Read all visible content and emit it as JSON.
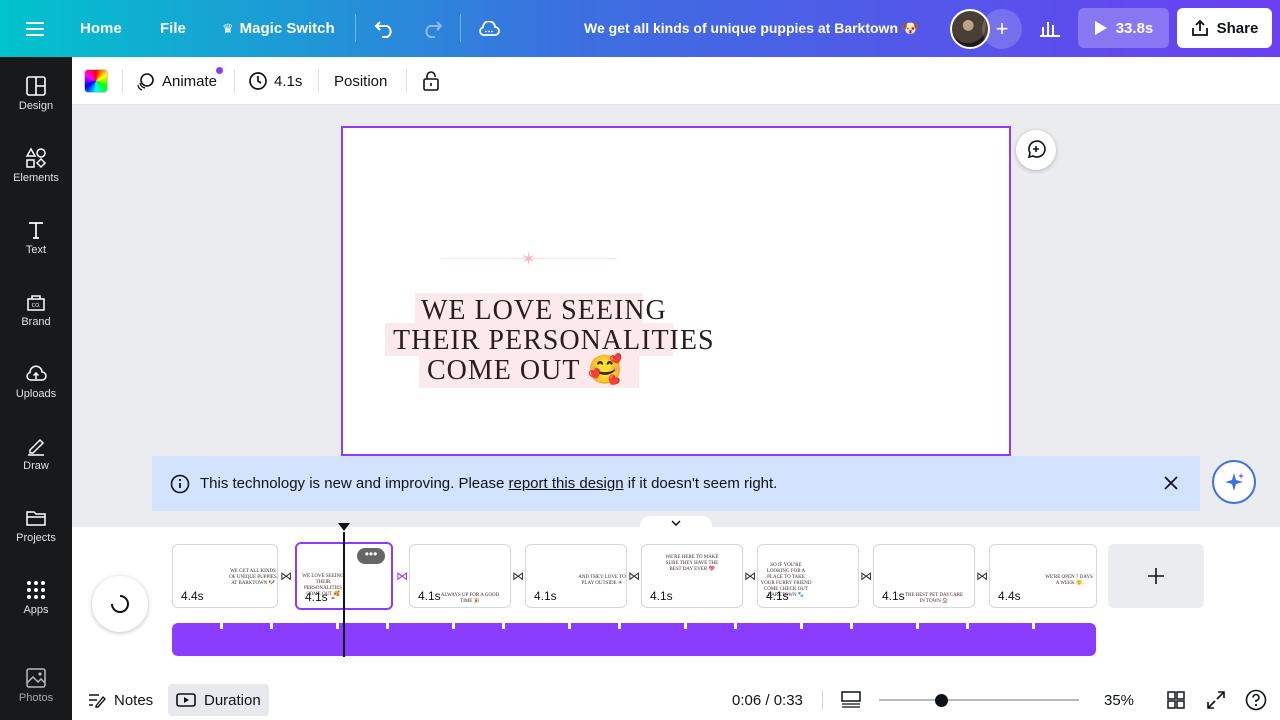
{
  "topbar": {
    "home": "Home",
    "file": "File",
    "magic_switch": "Magic Switch",
    "doc_title": "We get all kinds of unique puppies at Barktown 🐶",
    "play_time": "33.8s",
    "share": "Share"
  },
  "sidebar": {
    "items": [
      {
        "label": "Design",
        "icon": "layout-icon"
      },
      {
        "label": "Elements",
        "icon": "shapes-icon"
      },
      {
        "label": "Text",
        "icon": "text-icon"
      },
      {
        "label": "Brand",
        "icon": "brand-icon"
      },
      {
        "label": "Uploads",
        "icon": "upload-icon"
      },
      {
        "label": "Draw",
        "icon": "draw-icon"
      },
      {
        "label": "Projects",
        "icon": "folder-icon"
      },
      {
        "label": "Apps",
        "icon": "apps-icon"
      },
      {
        "label": "Photos",
        "icon": "photos-icon"
      }
    ]
  },
  "toolbar": {
    "animate": "Animate",
    "duration": "4.1s",
    "position": "Position"
  },
  "canvas": {
    "line1": "WE LOVE SEEING",
    "line2": "THEIR PERSONALITIES",
    "line3": "COME OUT 🥰"
  },
  "banner": {
    "text_before": "This technology is new and improving. Please ",
    "link": "report this design",
    "text_after": " if it doesn't seem right."
  },
  "scenes": [
    {
      "duration": "4.4s",
      "mini": "WE GET ALL KINDS OF UNIQUE PUPPIES AT BARKTOWN 🐶"
    },
    {
      "duration": "4.1s -",
      "mini": "WE LOVE SEEING THEIR PERSONALITIES COME OUT 🥰"
    },
    {
      "duration": "4.1s",
      "mini": "ALWAYS UP FOR A GOOD TIME 🎉"
    },
    {
      "duration": "4.1s",
      "mini": "AND THEY LOVE TO PLAY OUTSIDE ☀"
    },
    {
      "duration": "4.1s",
      "mini": "WE'RE HERE TO MAKE SURE THEY HAVE THE BEST DAY EVER 💖"
    },
    {
      "duration": "4.1s",
      "mini": "SO IF YOU'RE LOOKING FOR A PLACE TO TAKE YOUR FURRY FRIEND COME CHECK OUT BARKTOWN 🐾"
    },
    {
      "duration": "4.1s",
      "mini": "THE BEST PET DAYCARE IN TOWN 🏠"
    },
    {
      "duration": "4.4s",
      "mini": "WE'RE OPEN 7 DAYS A WEEK 🙂"
    }
  ],
  "bottombar": {
    "notes": "Notes",
    "duration": "Duration",
    "time": "0:06 / 0:33",
    "zoom": "35%"
  },
  "colors": {
    "accent": "#8b3dff",
    "banner_bg": "#d3e3fd",
    "sidebar_bg": "#18191b"
  }
}
